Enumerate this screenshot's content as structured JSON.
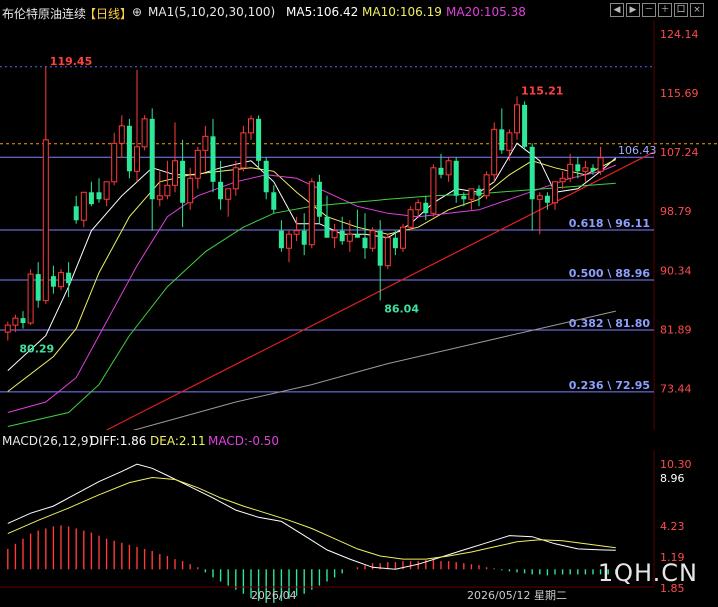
{
  "header": {
    "instrument": "布伦特原油连续",
    "period": "【日线】",
    "ma_label": "MA1(5,10,20,30,100)",
    "ma5": "MA5:106.42",
    "ma10": "MA10:106.19",
    "ma20": "MA20:105.38"
  },
  "toolbar": [
    "◀",
    "▶",
    "－",
    "＋",
    "口",
    "×"
  ],
  "colors": {
    "up": "#ff3a3a",
    "down": "#2ee89a",
    "ma5": "#ffffff",
    "ma10": "#f0f060",
    "ma20": "#e040e0",
    "ma30": "#40d040",
    "ma100": "#999999",
    "fib": "#8080ff",
    "trend": "#e02020",
    "price_line": "#f0a000"
  },
  "chart_data": {
    "type": "candlestick",
    "price_axis": {
      "ticks": [
        124.14,
        115.69,
        107.24,
        98.79,
        90.34,
        81.89,
        73.44
      ],
      "tick_labels": [
        "124.14",
        "115.69",
        "107.24",
        "98.79",
        "90.34",
        "81.89",
        "73.44"
      ],
      "range": [
        67.5,
        129.0
      ]
    },
    "current_price": "106.43",
    "annotations": [
      {
        "label": "119.45",
        "value": 119.45,
        "idx": 5,
        "color": "#ff4040"
      },
      {
        "label": "115.21",
        "value": 115.21,
        "idx": 67,
        "color": "#ff4040"
      },
      {
        "label": "86.04",
        "value": 86.04,
        "idx": 49,
        "color": "#40e0a0"
      },
      {
        "label": "80.29",
        "value": 80.29,
        "idx": 1,
        "color": "#40e0a0"
      }
    ],
    "fib_levels": [
      {
        "label": "0.618 \\ 96.11",
        "value": 96.11
      },
      {
        "label": "0.500 \\ 88.96",
        "value": 88.96
      },
      {
        "label": "0.382 \\ 81.80",
        "value": 81.8
      },
      {
        "label": "0.236 \\ 72.95",
        "value": 72.95
      }
    ],
    "candles": [
      [
        81.5,
        83.0,
        80.3,
        82.5
      ],
      [
        82.5,
        84.0,
        81.5,
        83.5
      ],
      [
        83.5,
        84.5,
        82.0,
        82.8
      ],
      [
        82.8,
        90.5,
        82.5,
        89.8
      ],
      [
        89.8,
        91.5,
        85.0,
        86.0
      ],
      [
        86.0,
        119.45,
        85.5,
        109.0
      ],
      [
        89.5,
        91.0,
        87.0,
        88.0
      ],
      [
        88.0,
        90.5,
        87.5,
        90.0
      ],
      [
        90.0,
        91.5,
        86.5,
        88.5
      ],
      [
        99.5,
        101.0,
        97.0,
        97.5
      ],
      [
        97.5,
        101.5,
        96.5,
        101.5
      ],
      [
        101.5,
        103.0,
        99.5,
        99.8
      ],
      [
        101.5,
        103.5,
        100.0,
        100.5
      ],
      [
        100.5,
        103.0,
        99.5,
        103.0
      ],
      [
        103.0,
        110.0,
        102.5,
        108.5
      ],
      [
        108.5,
        112.5,
        106.5,
        111.0
      ],
      [
        111.0,
        112.0,
        103.5,
        104.5
      ],
      [
        104.5,
        119.0,
        103.0,
        108.0
      ],
      [
        108.0,
        112.5,
        107.5,
        112.0
      ],
      [
        112.0,
        113.5,
        96.0,
        100.5
      ],
      [
        100.5,
        104.5,
        99.5,
        101.0
      ],
      [
        101.0,
        106.0,
        100.5,
        102.5
      ],
      [
        102.5,
        111.5,
        101.5,
        106.0
      ],
      [
        106.0,
        109.0,
        96.5,
        100.0
      ],
      [
        100.0,
        105.0,
        99.0,
        103.5
      ],
      [
        103.5,
        108.0,
        102.0,
        107.5
      ],
      [
        107.5,
        111.0,
        104.5,
        109.5
      ],
      [
        109.5,
        112.0,
        101.5,
        103.0
      ],
      [
        103.0,
        106.0,
        99.0,
        100.5
      ],
      [
        100.5,
        101.5,
        98.0,
        102.0
      ],
      [
        102.0,
        106.0,
        101.0,
        105.0
      ],
      [
        105.0,
        111.0,
        104.5,
        110.0
      ],
      [
        110.0,
        112.5,
        109.0,
        112.0
      ],
      [
        112.0,
        112.5,
        105.0,
        106.0
      ],
      [
        106.0,
        106.5,
        100.5,
        101.5
      ],
      [
        101.5,
        102.5,
        98.5,
        99.0
      ],
      [
        96.0,
        97.5,
        93.0,
        93.5
      ],
      [
        93.5,
        96.0,
        91.5,
        95.5
      ],
      [
        95.5,
        98.0,
        94.5,
        96.0
      ],
      [
        96.0,
        98.5,
        92.5,
        94.0
      ],
      [
        94.0,
        103.5,
        93.5,
        103.0
      ],
      [
        103.0,
        104.0,
        97.0,
        98.0
      ],
      [
        98.0,
        101.0,
        95.0,
        95.0
      ],
      [
        95.0,
        97.0,
        93.5,
        96.0
      ],
      [
        96.0,
        98.0,
        94.0,
        94.5
      ],
      [
        94.5,
        97.5,
        93.0,
        95.5
      ],
      [
        95.5,
        99.0,
        95.0,
        95.0
      ],
      [
        95.0,
        98.5,
        92.0,
        93.5
      ],
      [
        93.5,
        96.5,
        93.0,
        96.0
      ],
      [
        96.0,
        97.5,
        86.04,
        91.0
      ],
      [
        91.0,
        95.5,
        90.5,
        95.0
      ],
      [
        95.0,
        96.0,
        92.5,
        93.5
      ],
      [
        93.5,
        97.0,
        93.0,
        96.5
      ],
      [
        96.5,
        99.5,
        96.0,
        99.0
      ],
      [
        99.0,
        100.5,
        98.0,
        100.0
      ],
      [
        100.0,
        101.0,
        97.5,
        98.5
      ],
      [
        98.5,
        105.5,
        98.0,
        105.0
      ],
      [
        105.0,
        107.0,
        103.5,
        104.0
      ],
      [
        104.0,
        106.5,
        103.0,
        106.0
      ],
      [
        106.0,
        106.5,
        100.0,
        101.0
      ],
      [
        101.0,
        101.5,
        99.5,
        100.5
      ],
      [
        100.5,
        102.0,
        99.0,
        102.0
      ],
      [
        102.0,
        102.5,
        99.5,
        101.0
      ],
      [
        101.0,
        104.5,
        100.5,
        104.0
      ],
      [
        104.0,
        111.5,
        103.0,
        110.5
      ],
      [
        110.5,
        113.5,
        107.0,
        107.5
      ],
      [
        107.5,
        110.5,
        106.0,
        110.0
      ],
      [
        110.0,
        115.21,
        109.0,
        114.0
      ],
      [
        114.0,
        114.5,
        107.5,
        108.0
      ],
      [
        108.0,
        108.5,
        96.0,
        100.5
      ],
      [
        100.5,
        101.5,
        95.5,
        101.0
      ],
      [
        101.0,
        101.5,
        99.0,
        100.0
      ],
      [
        100.0,
        103.0,
        99.0,
        103.0
      ],
      [
        103.0,
        104.5,
        102.0,
        103.5
      ],
      [
        103.5,
        107.0,
        103.0,
        105.5
      ],
      [
        105.5,
        106.5,
        103.5,
        104.5
      ],
      [
        104.5,
        106.0,
        103.0,
        105.0
      ],
      [
        105.0,
        105.5,
        104.0,
        104.5
      ],
      [
        104.5,
        108.0,
        104.0,
        106.43
      ]
    ],
    "ma": {
      "ma5": [
        [
          0,
          76.0
        ],
        [
          5,
          81.0
        ],
        [
          8,
          88.0
        ],
        [
          11,
          96.0
        ],
        [
          15,
          101.0
        ],
        [
          19,
          105.0
        ],
        [
          22,
          104.0
        ],
        [
          25,
          104.0
        ],
        [
          28,
          105.0
        ],
        [
          32,
          106.0
        ],
        [
          35,
          103.0
        ],
        [
          38,
          97.0
        ],
        [
          41,
          97.0
        ],
        [
          44,
          95.5
        ],
        [
          47,
          95.5
        ],
        [
          50,
          95.0
        ],
        [
          53,
          97.0
        ],
        [
          56,
          100.0
        ],
        [
          59,
          102.0
        ],
        [
          62,
          101.5
        ],
        [
          64,
          103.0
        ],
        [
          67,
          108.5
        ],
        [
          70,
          106.0
        ],
        [
          72,
          101.5
        ],
        [
          75,
          102.0
        ],
        [
          78,
          104.5
        ],
        [
          80,
          106.42
        ]
      ],
      "ma10": [
        [
          0,
          73.0
        ],
        [
          6,
          78.0
        ],
        [
          9,
          82.0
        ],
        [
          12,
          90.0
        ],
        [
          16,
          98.0
        ],
        [
          20,
          103.0
        ],
        [
          24,
          104.0
        ],
        [
          28,
          104.5
        ],
        [
          32,
          105.0
        ],
        [
          35,
          104.5
        ],
        [
          38,
          101.5
        ],
        [
          42,
          98.0
        ],
        [
          46,
          96.5
        ],
        [
          50,
          95.5
        ],
        [
          54,
          96.5
        ],
        [
          58,
          99.0
        ],
        [
          62,
          100.5
        ],
        [
          66,
          104.0
        ],
        [
          69,
          106.0
        ],
        [
          72,
          105.0
        ],
        [
          76,
          104.0
        ],
        [
          80,
          106.19
        ]
      ],
      "ma20": [
        [
          0,
          70.0
        ],
        [
          5,
          71.5
        ],
        [
          9,
          75.0
        ],
        [
          13,
          83.0
        ],
        [
          17,
          91.0
        ],
        [
          21,
          98.0
        ],
        [
          25,
          101.0
        ],
        [
          30,
          103.0
        ],
        [
          34,
          104.0
        ],
        [
          38,
          103.5
        ],
        [
          42,
          101.5
        ],
        [
          46,
          99.5
        ],
        [
          50,
          98.5
        ],
        [
          54,
          98.0
        ],
        [
          58,
          98.5
        ],
        [
          62,
          99.0
        ],
        [
          66,
          100.5
        ],
        [
          70,
          102.0
        ],
        [
          74,
          103.5
        ],
        [
          78,
          104.5
        ],
        [
          80,
          105.38
        ]
      ],
      "ma30": [
        [
          0,
          68.0
        ],
        [
          8,
          70.0
        ],
        [
          12,
          74.0
        ],
        [
          16,
          81.0
        ],
        [
          21,
          88.0
        ],
        [
          26,
          93.0
        ],
        [
          31,
          96.5
        ],
        [
          35,
          98.5
        ],
        [
          40,
          99.5
        ],
        [
          45,
          100.0
        ],
        [
          50,
          100.5
        ],
        [
          56,
          101.0
        ],
        [
          62,
          101.3
        ],
        [
          68,
          101.8
        ],
        [
          74,
          102.3
        ],
        [
          80,
          102.8
        ]
      ],
      "ma100": [
        [
          0,
          63.0
        ],
        [
          10,
          65.5
        ],
        [
          20,
          68.5
        ],
        [
          30,
          71.5
        ],
        [
          40,
          74.0
        ],
        [
          50,
          77.0
        ],
        [
          60,
          79.5
        ],
        [
          70,
          82.0
        ],
        [
          80,
          84.5
        ]
      ]
    },
    "trendline": [
      [
        13,
        67.5
      ],
      [
        80,
        104.5
      ]
    ],
    "date_labels": [
      {
        "label": "2026/04",
        "idx": 35
      },
      {
        "label": "2026/05/12 星期二",
        "idx": 67
      }
    ],
    "macd": {
      "label": "MACD(26,12,9)",
      "diff_label": "DIFF:1.86",
      "dea_label": "DEA:2.11",
      "macd_label": "MACD:-0.50",
      "ticks": [
        10.3,
        8.96,
        4.23,
        1.19,
        -1.85
      ],
      "tick_labels": [
        "10.30",
        "8.96",
        "4.23",
        "1.19",
        "1.85"
      ],
      "range": [
        -3.5,
        11.5
      ],
      "diff": [
        [
          0,
          4.5
        ],
        [
          3,
          5.5
        ],
        [
          6,
          6.2
        ],
        [
          9,
          7.4
        ],
        [
          12,
          8.6
        ],
        [
          15,
          9.6
        ],
        [
          17,
          10.3
        ],
        [
          19,
          9.9
        ],
        [
          21,
          9.2
        ],
        [
          24,
          8.1
        ],
        [
          27,
          7.0
        ],
        [
          30,
          5.8
        ],
        [
          33,
          5.1
        ],
        [
          36,
          4.7
        ],
        [
          39,
          3.3
        ],
        [
          42,
          1.9
        ],
        [
          45,
          1.0
        ],
        [
          48,
          0.2
        ],
        [
          51,
          0.0
        ],
        [
          54,
          0.5
        ],
        [
          57,
          1.2
        ],
        [
          60,
          1.9
        ],
        [
          63,
          2.6
        ],
        [
          66,
          3.3
        ],
        [
          69,
          3.2
        ],
        [
          72,
          2.5
        ],
        [
          75,
          2.0
        ],
        [
          78,
          1.9
        ],
        [
          80,
          1.86
        ]
      ],
      "dea": [
        [
          0,
          3.5
        ],
        [
          4,
          4.8
        ],
        [
          8,
          6.0
        ],
        [
          12,
          7.3
        ],
        [
          16,
          8.5
        ],
        [
          19,
          9.0
        ],
        [
          22,
          8.8
        ],
        [
          25,
          8.0
        ],
        [
          28,
          7.0
        ],
        [
          31,
          6.2
        ],
        [
          34,
          5.5
        ],
        [
          37,
          4.8
        ],
        [
          40,
          4.0
        ],
        [
          43,
          3.0
        ],
        [
          46,
          2.0
        ],
        [
          49,
          1.3
        ],
        [
          52,
          1.0
        ],
        [
          55,
          1.0
        ],
        [
          58,
          1.3
        ],
        [
          61,
          1.7
        ],
        [
          64,
          2.2
        ],
        [
          67,
          2.7
        ],
        [
          70,
          2.9
        ],
        [
          73,
          2.8
        ],
        [
          76,
          2.5
        ],
        [
          80,
          2.11
        ]
      ],
      "hist": [
        2.0,
        2.5,
        3.0,
        3.5,
        3.8,
        4.0,
        4.2,
        4.3,
        4.2,
        4.0,
        3.8,
        3.6,
        3.3,
        3.0,
        2.8,
        2.6,
        2.4,
        2.2,
        2.0,
        1.8,
        1.5,
        1.3,
        1.0,
        0.8,
        0.5,
        0.2,
        -0.3,
        -0.8,
        -1.2,
        -1.6,
        -2.0,
        -2.4,
        -2.8,
        -3.1,
        -3.3,
        -3.3,
        -3.1,
        -2.9,
        -2.6,
        -2.4,
        -2.0,
        -1.6,
        -1.2,
        -0.8,
        -0.4,
        0.0,
        0.2,
        0.4,
        0.6,
        0.6,
        0.7,
        0.7,
        0.8,
        0.8,
        0.8,
        0.9,
        0.9,
        0.8,
        0.8,
        0.7,
        0.6,
        0.5,
        0.4,
        0.2,
        0.1,
        -0.1,
        -0.2,
        -0.3,
        -0.4,
        -0.5,
        -0.5,
        -0.6,
        -0.5,
        -0.5,
        -0.5,
        -0.5,
        -0.5,
        -0.5,
        -0.5,
        -0.5,
        -0.5
      ]
    }
  },
  "watermark": "1QH.CN"
}
